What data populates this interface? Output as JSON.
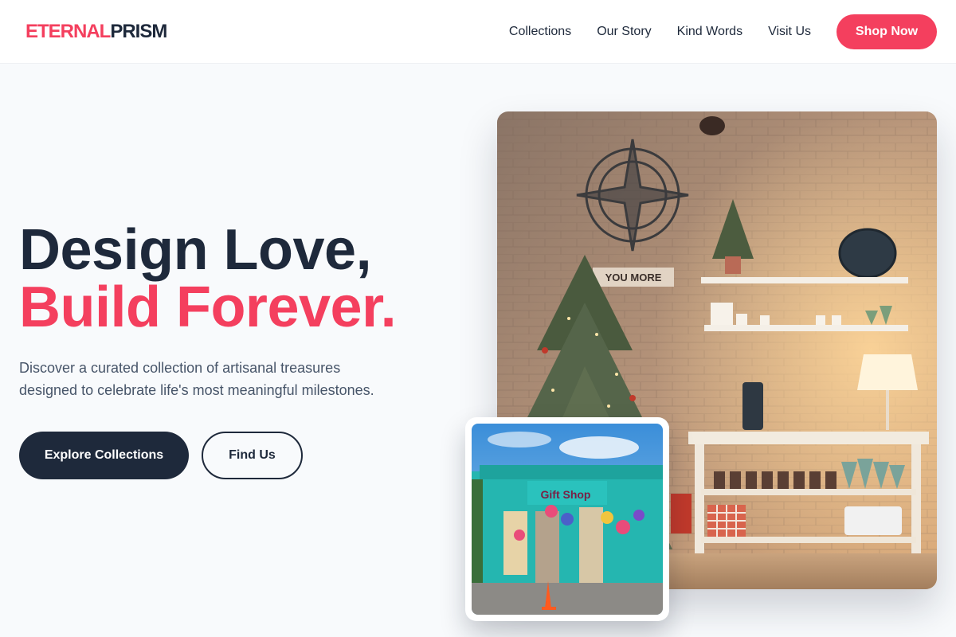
{
  "brand": {
    "part1": "ETERNAL",
    "part2": "PRISM"
  },
  "nav": {
    "items": [
      "Collections",
      "Our Story",
      "Kind Words",
      "Visit Us"
    ],
    "cta": "Shop Now"
  },
  "hero": {
    "title_line1": "Design Love,",
    "title_line2": "Build Forever.",
    "description": "Discover a curated collection of artisanal treasures designed to celebrate life's most meaningful milestones.",
    "primary_button": "Explore Collections",
    "secondary_button": "Find Us"
  },
  "images": {
    "main": {
      "sign_text": "YOU MORE"
    },
    "small": {
      "sign_text": "Gift Shop"
    }
  },
  "colors": {
    "accent": "#f43f5e",
    "dark": "#1e293b",
    "muted": "#475569",
    "background": "#f8fafc"
  }
}
